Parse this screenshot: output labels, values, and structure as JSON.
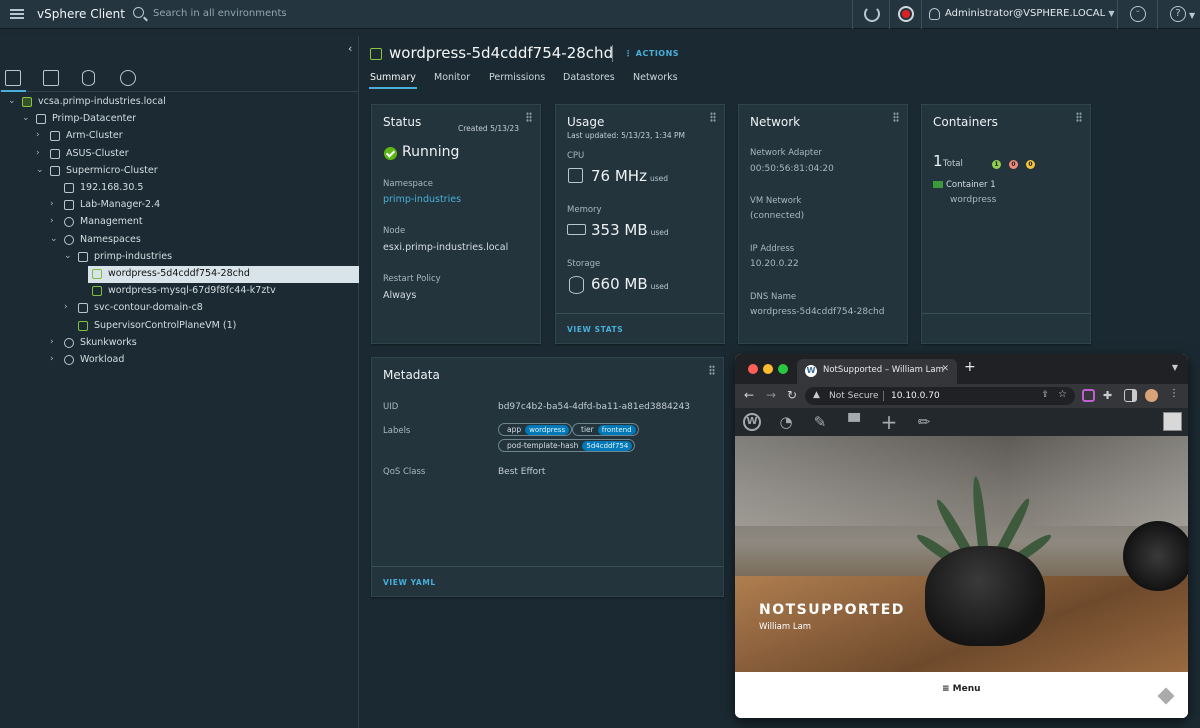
{
  "header": {
    "app_title": "vSphere Client",
    "search_placeholder": "Search in all environments",
    "user": "Administrator@VSPHERE.LOCAL",
    "help": "?"
  },
  "sidebar": {
    "tree": [
      {
        "label": "vcsa.primp-industries.local",
        "expanded": true,
        "icon": "vcenter-icon"
      },
      {
        "label": "Primp-Datacenter",
        "expanded": true,
        "icon": "datacenter-icon"
      },
      {
        "label": "Arm-Cluster",
        "expanded": false,
        "icon": "cluster-icon"
      },
      {
        "label": "ASUS-Cluster",
        "expanded": false,
        "icon": "cluster-icon"
      },
      {
        "label": "Supermicro-Cluster",
        "expanded": true,
        "icon": "cluster-icon"
      },
      {
        "label": "192.168.30.5",
        "expanded": null,
        "icon": "host-icon"
      },
      {
        "label": "Lab-Manager-2.4",
        "expanded": false,
        "icon": "vapp-icon"
      },
      {
        "label": "Management",
        "expanded": false,
        "icon": "resource-pool-icon"
      },
      {
        "label": "Namespaces",
        "expanded": true,
        "icon": "resource-pool-icon"
      },
      {
        "label": "primp-industries",
        "expanded": true,
        "icon": "namespace-icon"
      },
      {
        "label": "wordpress-5d4cddf754-28chd",
        "expanded": null,
        "icon": "pod-icon",
        "selected": true
      },
      {
        "label": "wordpress-mysql-67d9f8fc44-k7ztv",
        "expanded": null,
        "icon": "pod-icon"
      },
      {
        "label": "svc-contour-domain-c8",
        "expanded": false,
        "icon": "namespace-icon"
      },
      {
        "label": "SupervisorControlPlaneVM (1)",
        "expanded": null,
        "icon": "vm-group-icon"
      },
      {
        "label": "Skunkworks",
        "expanded": false,
        "icon": "resource-pool-icon"
      },
      {
        "label": "Workload",
        "expanded": false,
        "icon": "resource-pool-icon"
      }
    ]
  },
  "object": {
    "title": "wordpress-5d4cddf754-28chd",
    "actions": "ACTIONS",
    "tabs": [
      "Summary",
      "Monitor",
      "Permissions",
      "Datastores",
      "Networks"
    ]
  },
  "status_card": {
    "title": "Status",
    "created": "Created 5/13/23",
    "state": "Running",
    "namespace_label": "Namespace",
    "namespace_value": "primp-industries",
    "node_label": "Node",
    "node_value": "esxi.primp-industries.local",
    "restart_label": "Restart Policy",
    "restart_value": "Always"
  },
  "usage_card": {
    "title": "Usage",
    "updated": "Last updated: 5/13/23, 1:34 PM",
    "cpu_label": "CPU",
    "cpu_value": "76 MHz",
    "memory_label": "Memory",
    "memory_value": "353 MB",
    "storage_label": "Storage",
    "storage_value": "660 MB",
    "used": "used",
    "footer": "VIEW STATS"
  },
  "network_card": {
    "title": "Network",
    "adapter_label": "Network Adapter",
    "adapter_value": "00:50:56:81:04:20",
    "vmnet_label": "VM Network",
    "vmnet_value": "(connected)",
    "ip_label": "IP Address",
    "ip_value": "10.20.0.22",
    "dns_label": "DNS Name",
    "dns_value": "wordpress-5d4cddf754-28chd"
  },
  "containers_card": {
    "title": "Containers",
    "count": "1",
    "total_label": "Total",
    "status_counts": [
      "1",
      "0",
      "0"
    ],
    "container_name": "Container 1",
    "container_image": "wordpress"
  },
  "metadata_card": {
    "title": "Metadata",
    "uid_label": "UID",
    "uid_value": "bd97c4b2-ba54-4dfd-ba11-a81ed3884243",
    "labels_label": "Labels",
    "labels": [
      {
        "key": "app",
        "value": "wordpress"
      },
      {
        "key": "tier",
        "value": "frontend"
      },
      {
        "key": "pod-template-hash",
        "value": "5d4cddf754"
      }
    ],
    "qos_label": "QoS Class",
    "qos_value": "Best Effort",
    "footer": "VIEW YAML"
  },
  "browser": {
    "tab_title": "NotSupported – William Lam",
    "not_secure": "Not Secure",
    "address": "10.10.0.70",
    "site_title": "NOTSUPPORTED",
    "site_subtitle": "William Lam",
    "menu_label": "≡  Menu"
  },
  "colors": {
    "accent": "#49afd9",
    "running": "#5eb715",
    "header_bg": "#253540",
    "body_bg": "#1b2a32"
  }
}
